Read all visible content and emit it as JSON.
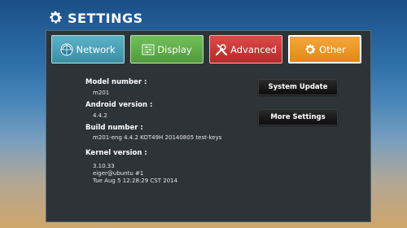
{
  "header": {
    "title": "SETTINGS",
    "icon": "gear-icon"
  },
  "tabs": [
    {
      "label": "Network",
      "icon": "network-icon",
      "color": "#4aa3b9"
    },
    {
      "label": "Display",
      "icon": "display-sliders-icon",
      "color": "#5fae48"
    },
    {
      "label": "Advanced",
      "icon": "tools-icon",
      "color": "#cf3a3a"
    },
    {
      "label": "Other",
      "icon": "gear-icon",
      "color": "#ef9b28",
      "selected": true
    }
  ],
  "info": {
    "model_label": "Model number :",
    "model_value": "m201",
    "android_label": "Android version :",
    "android_value": "4.4.2",
    "build_label": "Build number :",
    "build_value": "m201-eng 4.4.2 KOT49H 20140805 test-keys",
    "kernel_label": "Kernel version :",
    "kernel_line1": "3.10.33",
    "kernel_line2": "eiger@ubuntu #1",
    "kernel_line3": "Tue Aug 5 12:28:29 CST 2014"
  },
  "buttons": {
    "system_update": "System Update",
    "more_settings": "More Settings"
  }
}
